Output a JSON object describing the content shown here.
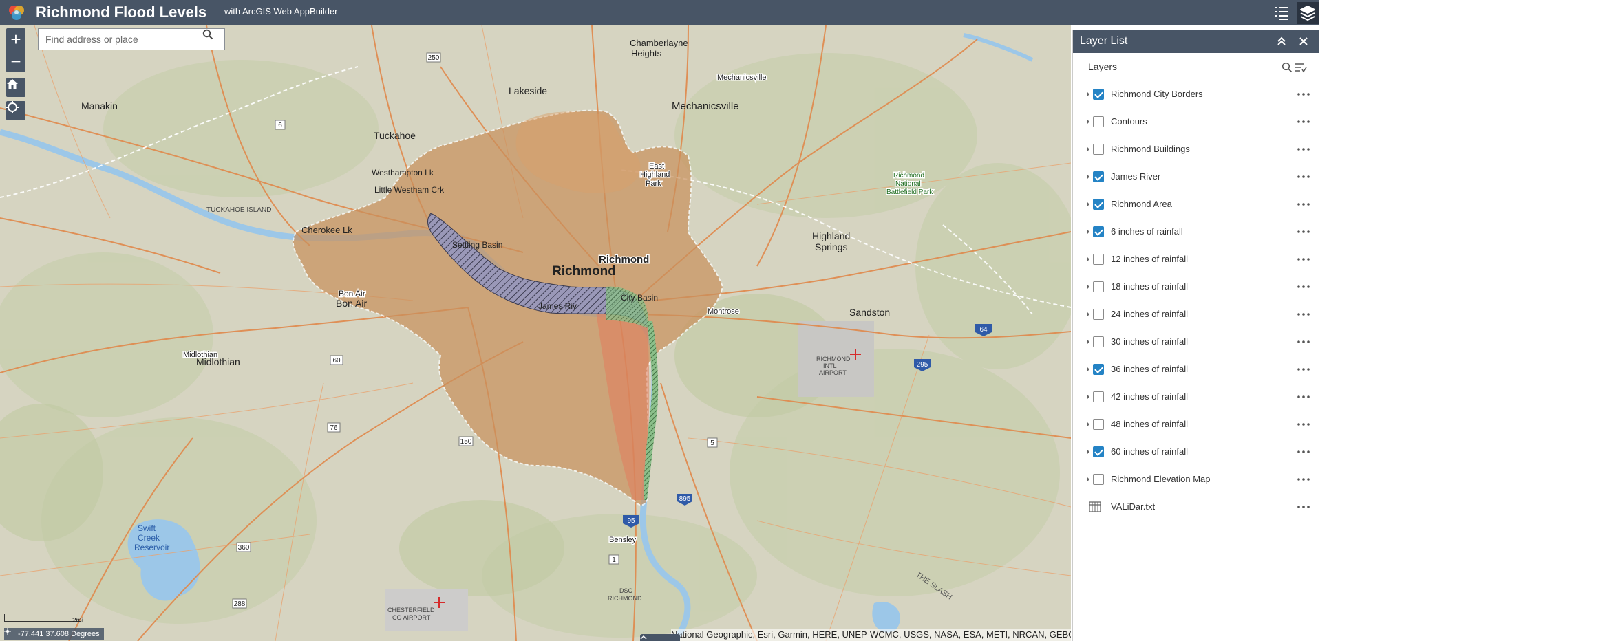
{
  "app": {
    "title": "Richmond Flood Levels",
    "subtitle": "with ArcGIS Web AppBuilder"
  },
  "colors": {
    "header_bg": "#485566",
    "checkbox_on": "#2483c5",
    "flood_fill": "#c9905c",
    "river": "#9cc7e8"
  },
  "header_icons": [
    "layer-list-widget-icon",
    "basemap-layers-icon"
  ],
  "search": {
    "placeholder": "Find address or place"
  },
  "map_controls": {
    "zoom_in": "+",
    "zoom_out": "−"
  },
  "coordinates": {
    "text": "-77.441 37.608 Degrees"
  },
  "scale": {
    "label": "2mi"
  },
  "attribution": {
    "text": "National Geographic, Esri, Garmin, HERE, UNEP-WCMC, USGS, NASA, ESA, METI, NRCAN, GEBCO"
  },
  "map_labels": [
    "Manakin",
    "Tuckahoe",
    "Westhampton Lk",
    "Little Westham Crk",
    "TUCKAHOE ISLAND",
    "Cherokee Lk",
    "Settling Basin",
    "Richmond",
    "Richmond",
    "James Riv",
    "City Basin",
    "Bon Air",
    "Bon Air",
    "Midlothian",
    "Midlothian",
    "Lakeside",
    "Chamberlayne Heights",
    "Mechanicsville",
    "Mechanicsville",
    "East Highland Park",
    "Highland Springs",
    "Sandston",
    "Montrose",
    "Richmond National Battlefield Park",
    "RICHMOND INTL AIRPORT",
    "Swift Creek Reservoir",
    "Bensley",
    "DSC RICHMOND",
    "CHESTERFIELD CO AIRPORT",
    "THE SLASH"
  ],
  "panel": {
    "title": "Layer List",
    "layers_label": "Layers",
    "layers": [
      {
        "name": "Richmond City Borders",
        "checked": true
      },
      {
        "name": "Contours",
        "checked": false
      },
      {
        "name": "Richmond Buildings",
        "checked": false
      },
      {
        "name": "James River",
        "checked": true
      },
      {
        "name": "Richmond Area",
        "checked": true
      },
      {
        "name": "6 inches of rainfall",
        "checked": true
      },
      {
        "name": "12 inches of rainfall",
        "checked": false
      },
      {
        "name": "18 inches of rainfall",
        "checked": false
      },
      {
        "name": "24 inches of rainfall",
        "checked": false
      },
      {
        "name": "30 inches of rainfall",
        "checked": false
      },
      {
        "name": "36 inches of rainfall",
        "checked": true
      },
      {
        "name": "42 inches of rainfall",
        "checked": false
      },
      {
        "name": "48 inches of rainfall",
        "checked": false
      },
      {
        "name": "60 inches of rainfall",
        "checked": true
      },
      {
        "name": "Richmond Elevation Map",
        "checked": false
      }
    ],
    "table_layer": "VALiDar.txt"
  }
}
